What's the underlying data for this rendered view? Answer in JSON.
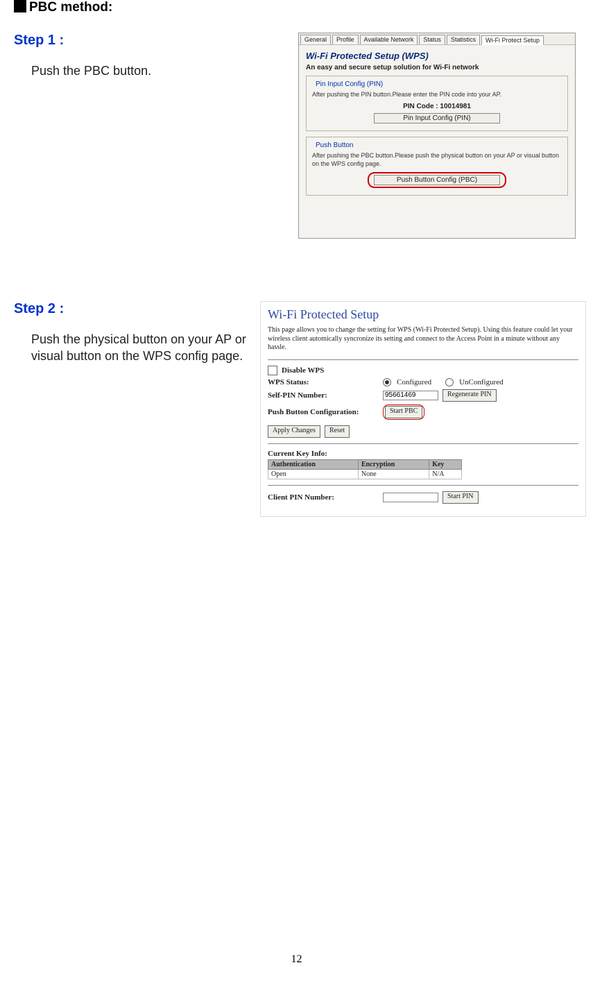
{
  "header": {
    "title": "PBC method:"
  },
  "step1": {
    "heading": "Step 1 :",
    "body": "Push the PBC button."
  },
  "step2": {
    "heading": "Step 2 :",
    "body": "Push the physical button on your AP or visual button on the WPS config page."
  },
  "shot1": {
    "tabs": {
      "general": "General",
      "profile": "Profile",
      "available": "Available Network",
      "status": "Status",
      "statistics": "Statistics",
      "wps": "Wi-Fi Protect Setup"
    },
    "title": "Wi-Fi Protected Setup (WPS)",
    "subtitle": "An easy and secure setup solution for Wi-Fi network",
    "pin": {
      "legend": "Pin Input Config (PIN)",
      "text": "After pushing the PIN button.Please enter the PIN code into your AP.",
      "codeLabel": "PIN Code :  10014981",
      "button": "Pin Input Config (PIN)"
    },
    "pbc": {
      "legend": "Push Button",
      "text": "After pushing the PBC button.Please push the physical button on your AP or visual button on the WPS config page.",
      "button": "Push Button Config (PBC)"
    }
  },
  "shot2": {
    "title": "Wi-Fi Protected Setup",
    "intro": "This page allows you to change the setting for WPS (Wi-Fi Protected Setup). Using this feature could let your wireless client automically syncronize its setting and connect to the Access Point in a minute without any hassle.",
    "disableWps": "Disable WPS",
    "wpsStatusLabel": "WPS Status:",
    "configured": "Configured",
    "unconfigured": "UnConfigured",
    "selfPinLabel": "Self-PIN Number:",
    "selfPinValue": "95661469",
    "regenerate": "Regenerate PIN",
    "pbcLabel": "Push Button Configuration:",
    "startPbc": "Start PBC",
    "applyChanges": "Apply Changes",
    "reset": "Reset",
    "currentKeyInfo": "Current Key Info:",
    "table": {
      "hAuth": "Authentication",
      "hEnc": "Encryption",
      "hKey": "Key",
      "auth": "Open",
      "enc": "None",
      "key": "N/A"
    },
    "clientPinLabel": "Client PIN Number:",
    "startPin": "Start PIN"
  },
  "pageNumber": "12"
}
